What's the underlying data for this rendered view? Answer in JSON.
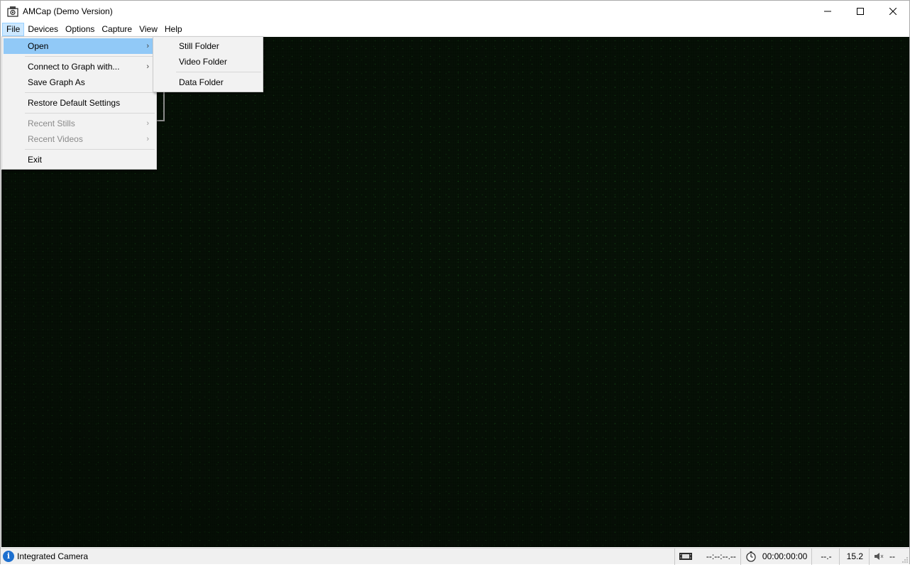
{
  "window": {
    "title": "AMCap (Demo Version)",
    "controls": {
      "minimize": "—",
      "maximize": "☐",
      "close": "✕"
    }
  },
  "menubar": {
    "items": [
      "File",
      "Devices",
      "Options",
      "Capture",
      "View",
      "Help"
    ],
    "active": "File"
  },
  "file_menu": {
    "items": [
      {
        "label": "Open",
        "arrow": "›"
      },
      {
        "label": "Connect to Graph with...",
        "arrow": "›"
      },
      {
        "label": "Save Graph As"
      },
      {
        "label": "Restore Default Settings"
      },
      {
        "label": "Recent Stills",
        "arrow": "›"
      },
      {
        "label": "Recent Videos",
        "arrow": "›"
      },
      {
        "label": "Exit"
      }
    ]
  },
  "open_submenu": {
    "items": [
      "Still Folder",
      "Video Folder",
      "Data Folder"
    ]
  },
  "statusbar": {
    "device": "Integrated Camera",
    "frame_time": "--:--:--.--",
    "capture_time": "00:00:00:00",
    "dropped": "--.-",
    "fps": "15.2",
    "audio": "--"
  }
}
